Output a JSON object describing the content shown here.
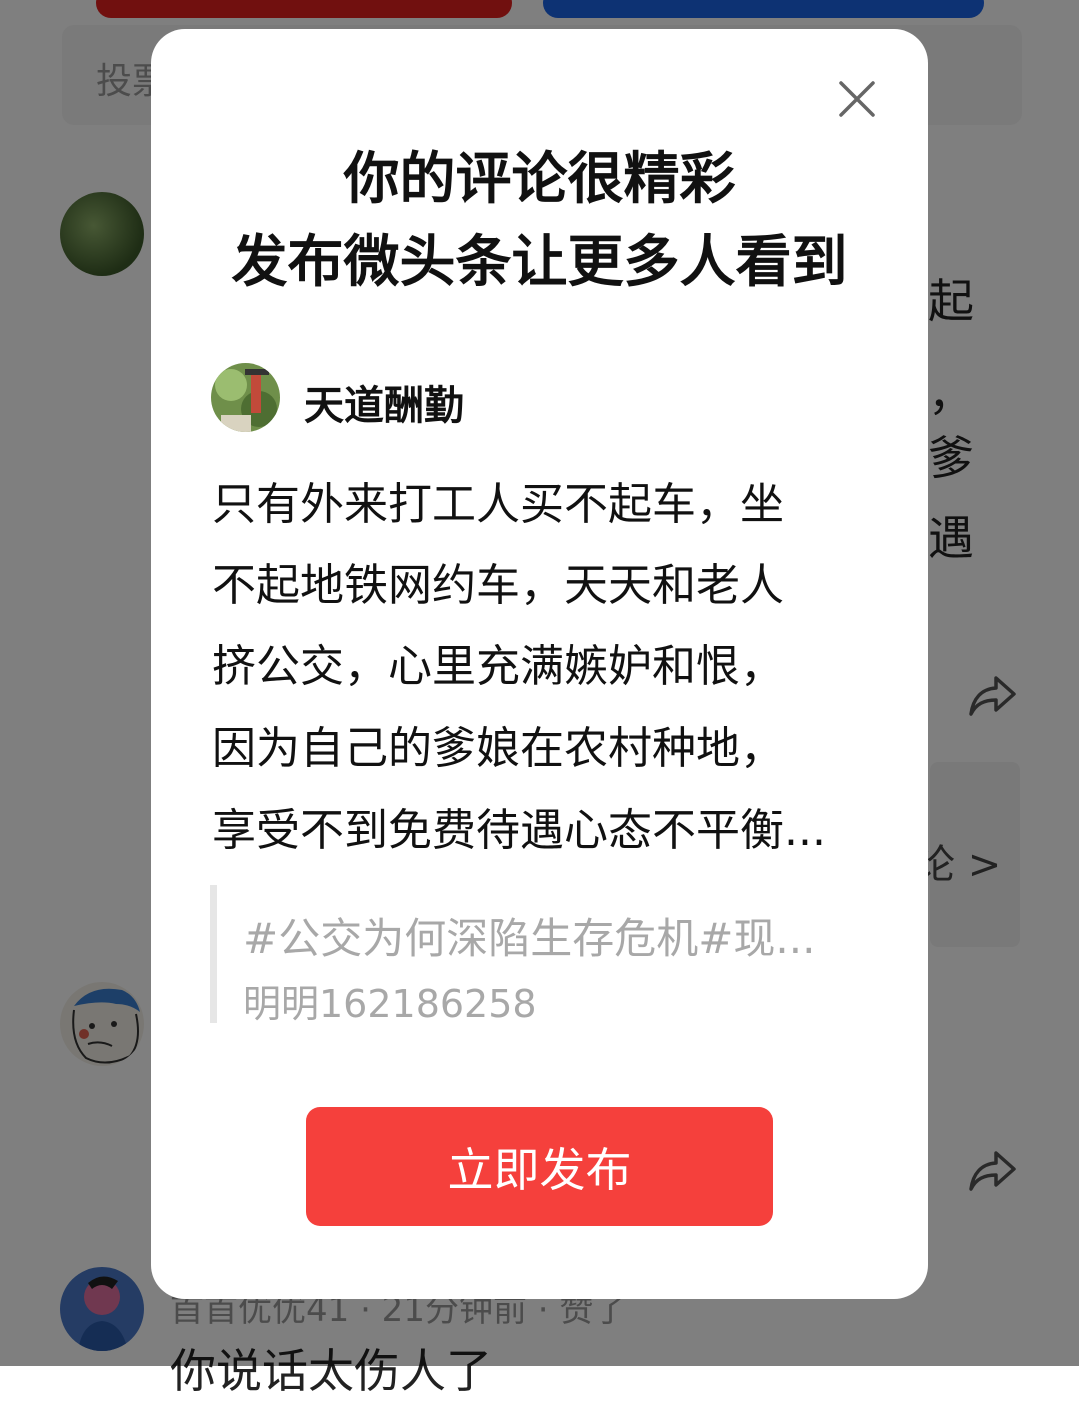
{
  "background": {
    "vote_label": "投票",
    "right_text_fragments": [
      "起",
      "，",
      "爹",
      "遇"
    ],
    "card_text": "论 >",
    "meta": "首首优优41 · 21分钟前 · 赞了",
    "bottom_text": "你说话太伤人了"
  },
  "modal": {
    "title_line1": "你的评论很精彩",
    "title_line2": "发布微头条让更多人看到",
    "author": "天道酬勤",
    "comment_lines": [
      "只有外来打工人买不起车，坐",
      "不起地铁网约车，天天和老人",
      "挤公交，心里充满嫉妒和恨，",
      "因为自己的爹娘在农村种地，",
      "享受不到免费待遇心态不平衡..."
    ],
    "quote_topic": "#公交为何深陷生存危机#现...",
    "quote_user": "明明162186258",
    "publish_button": "立即发布"
  },
  "colors": {
    "overlay": "rgba(0,0,0,0.5)",
    "publish": "#f5403c",
    "vote_red": "#e3201f",
    "vote_blue": "#1a64e6"
  },
  "icons": [
    "close-icon",
    "share-icon"
  ]
}
